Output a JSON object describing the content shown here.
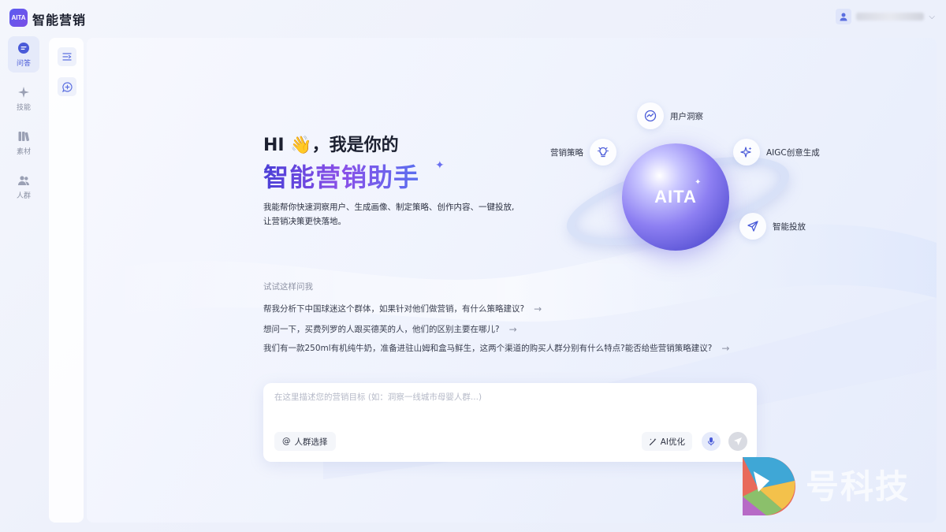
{
  "app": {
    "logo_text": "AITA",
    "title": "智能营销"
  },
  "user": {
    "name": ""
  },
  "nav": {
    "items": [
      {
        "label": "问答",
        "icon": "chat-icon",
        "active": true
      },
      {
        "label": "技能",
        "icon": "sparkle-icon",
        "active": false
      },
      {
        "label": "素材",
        "icon": "books-icon",
        "active": false
      },
      {
        "label": "人群",
        "icon": "people-icon",
        "active": false
      }
    ]
  },
  "hero": {
    "greeting": "HI 👋，我是你的",
    "title": "智能营销助手",
    "intro_line1": "我能帮你快速洞察用户、生成画像、制定策略、创作内容、一键投放,",
    "intro_line2": "让营销决策更快落地。"
  },
  "orb": {
    "text": "AITA",
    "capabilities": [
      {
        "label": "用户洞察",
        "icon": "chart-circle-icon"
      },
      {
        "label": "营销策略",
        "icon": "lightbulb-icon"
      },
      {
        "label": "AIGC创意生成",
        "icon": "sparkles-icon"
      },
      {
        "label": "智能投放",
        "icon": "send-icon"
      }
    ]
  },
  "suggestions": {
    "title": "试试这样问我",
    "items": [
      "帮我分析下中国球迷这个群体，如果针对他们做营销，有什么策略建议?",
      "想问一下，买费列罗的人跟买德芙的人，他们的区别主要在哪儿?",
      "我们有一款250ml有机纯牛奶，准备进驻山姆和盒马鲜生，这两个渠道的购买人群分别有什么特点?能否给些营销策略建议?"
    ]
  },
  "composer": {
    "placeholder": "在这里描述您的营销目标 (如：洞察一线城市母婴人群...)",
    "audience_label": "人群选择",
    "ai_label": "AI优化"
  },
  "watermark": {
    "text": "号科技"
  },
  "colors": {
    "accent": "#5b5cf0",
    "brand_gradient_start": "#4a3fd6",
    "brand_gradient_end": "#8a4fe8"
  }
}
